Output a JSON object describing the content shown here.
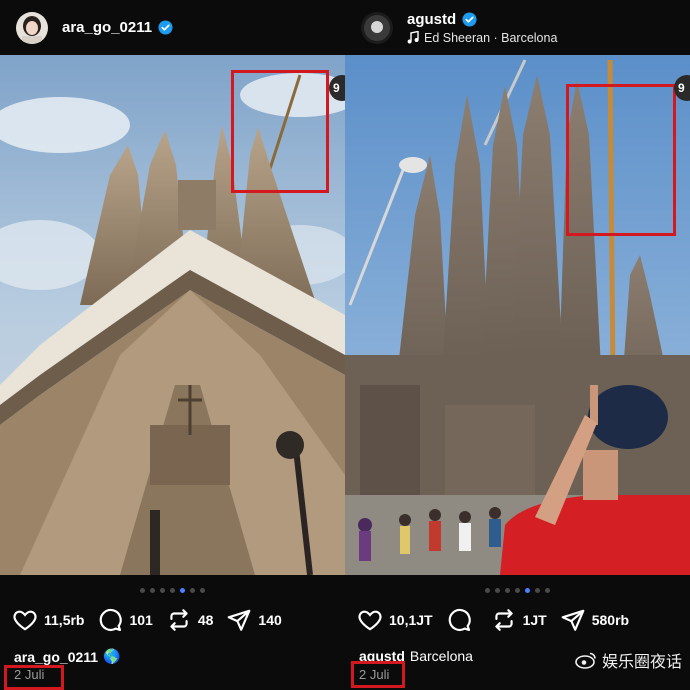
{
  "left_post": {
    "username": "ara_go_0211",
    "verified": true,
    "slide_indicator_partial": "9",
    "carousel": {
      "count": 7,
      "active_index": 4
    },
    "actions": {
      "likes": "11,5rb",
      "comments": "101",
      "reposts": "48",
      "shares": "140"
    },
    "caption_username": "ara_go_0211",
    "caption_emoji": "🌎",
    "date": "2 Juli"
  },
  "right_post": {
    "username": "agustd",
    "verified": true,
    "music_info": "Ed Sheeran · Barcelona",
    "slide_indicator_partial": "9",
    "carousel": {
      "count": 7,
      "active_index": 4
    },
    "actions": {
      "likes": "10,1JT",
      "comments": "",
      "reposts": "1JT",
      "shares": "580rb"
    },
    "caption_username": "agustd",
    "caption_text": "Barcelona",
    "date": "2 Juli"
  },
  "watermark": {
    "text": "娱乐圈夜话"
  },
  "icons": {
    "verified": "verified-badge-icon",
    "music": "music-note-icon",
    "like": "heart-icon",
    "comment": "comment-icon",
    "repost": "repost-icon",
    "share": "send-icon"
  },
  "colors": {
    "background": "#0b0b0b",
    "verified_blue": "#1d9bf0",
    "highlight_red": "#d31820",
    "carousel_active": "#4f7dff"
  }
}
